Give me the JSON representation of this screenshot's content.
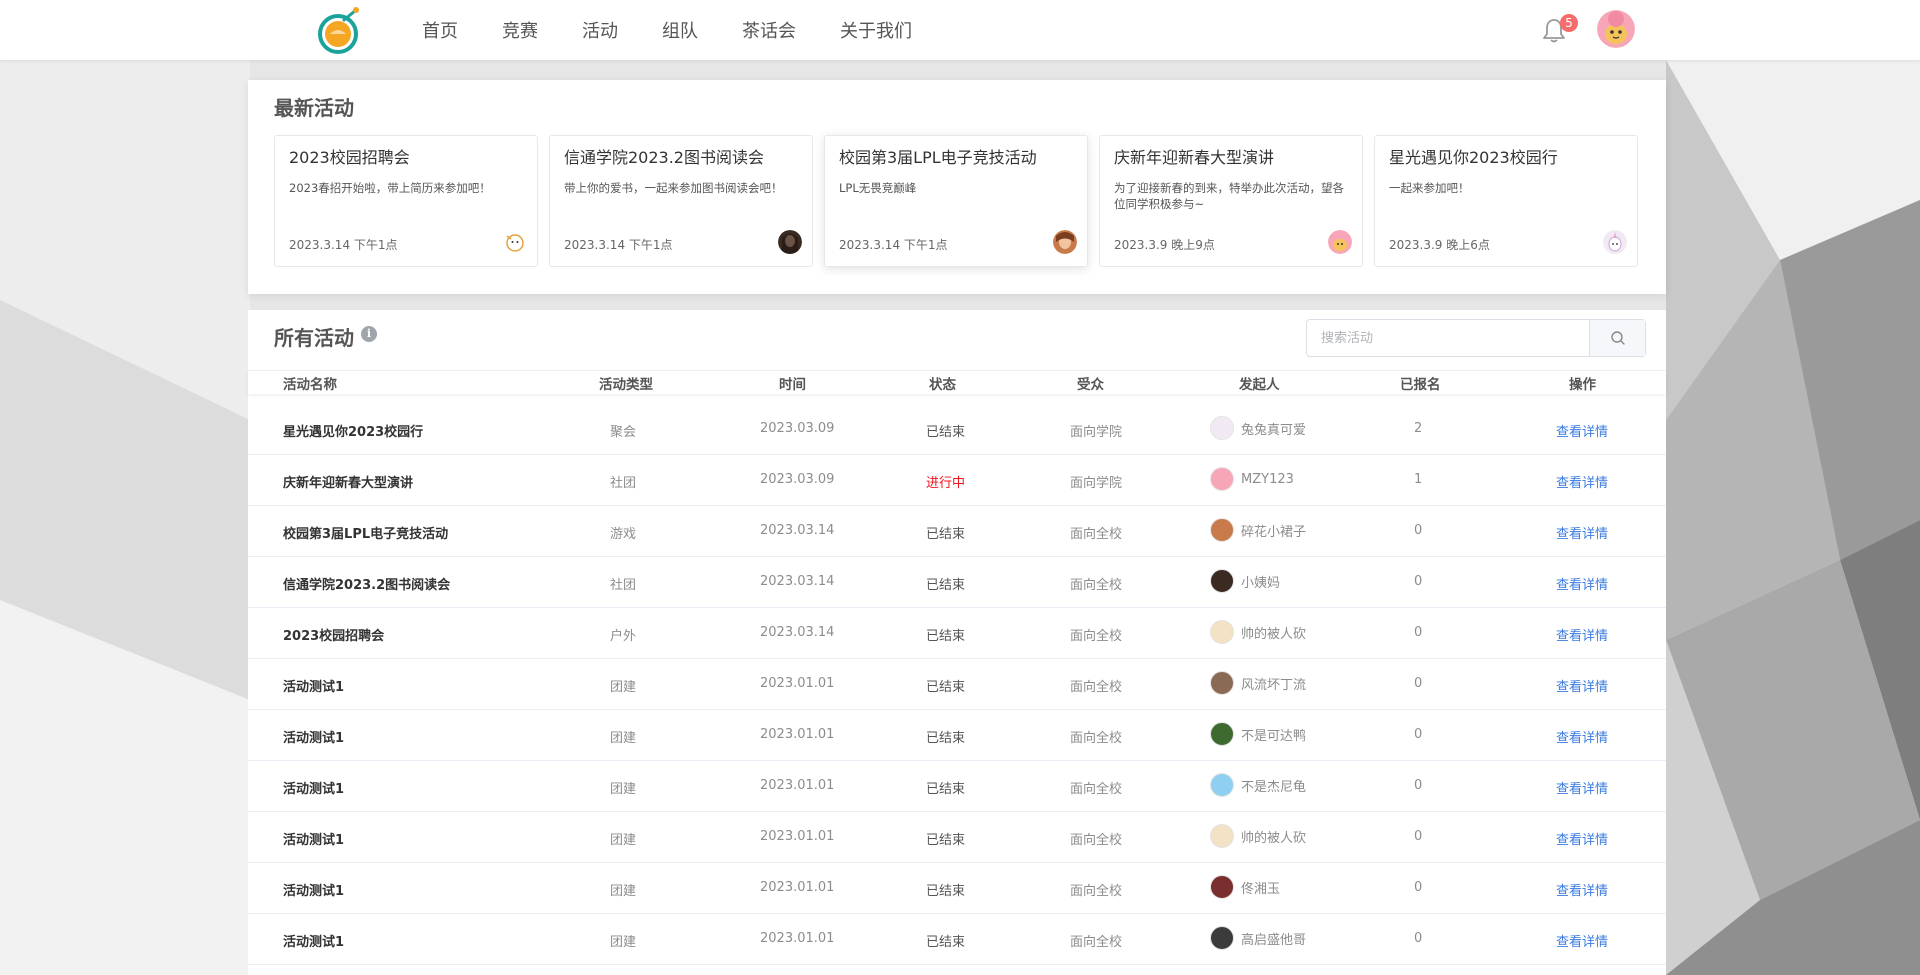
{
  "nav": {
    "items": [
      "首页",
      "竞赛",
      "活动",
      "组队",
      "茶话会",
      "关于我们"
    ]
  },
  "header": {
    "notification_count": "5"
  },
  "latest": {
    "title": "最新活动",
    "cards": [
      {
        "title": "2023校园招聘会",
        "desc": "2023春招开始啦，带上简历来参加吧！",
        "time": "2023.3.14 下午1点",
        "avatar_icon": "cartoon-avatar-icon"
      },
      {
        "title": "信通学院2023.2图书阅读会",
        "desc": "带上你的爱书，一起来参加图书阅读会吧！",
        "time": "2023.3.14 下午1点",
        "avatar_icon": "photo-avatar-icon"
      },
      {
        "title": "校园第3届LPL电子竞技活动",
        "desc": "LPL无畏竞巅峰",
        "time": "2023.3.14 下午1点",
        "avatar_icon": "photo-avatar-icon"
      },
      {
        "title": "庆新年迎新春大型演讲",
        "desc": "为了迎接新春的到来，特举办此次活动，望各位同学积极参与~",
        "time": "2023.3.9 晚上9点",
        "avatar_icon": "dog-avatar-icon"
      },
      {
        "title": "星光遇见你2023校园行",
        "desc": "一起来参加吧！",
        "time": "2023.3.9 晚上6点",
        "avatar_icon": "unicorn-avatar-icon"
      }
    ]
  },
  "all": {
    "title": "所有活动",
    "search_placeholder": "搜索活动",
    "columns": [
      "活动名称",
      "活动类型",
      "时间",
      "状态",
      "受众",
      "发起人",
      "已报名",
      "操作"
    ],
    "rows": [
      {
        "name": "星光遇见你2023校园行",
        "type": "聚会",
        "date": "2023.03.09",
        "status": "已结束",
        "active": false,
        "audience": "面向学院",
        "organizer": "兔兔真可爱",
        "count": "2",
        "action": "查看详情"
      },
      {
        "name": "庆新年迎新春大型演讲",
        "type": "社团",
        "date": "2023.03.09",
        "status": "进行中",
        "active": true,
        "audience": "面向学院",
        "organizer": "MZY123",
        "count": "1",
        "action": "查看详情"
      },
      {
        "name": "校园第3届LPL电子竞技活动",
        "type": "游戏",
        "date": "2023.03.14",
        "status": "已结束",
        "active": false,
        "audience": "面向全校",
        "organizer": "碎花小裙子",
        "count": "0",
        "action": "查看详情"
      },
      {
        "name": "信通学院2023.2图书阅读会",
        "type": "社团",
        "date": "2023.03.14",
        "status": "已结束",
        "active": false,
        "audience": "面向全校",
        "organizer": "小姨妈",
        "count": "0",
        "action": "查看详情"
      },
      {
        "name": "2023校园招聘会",
        "type": "户外",
        "date": "2023.03.14",
        "status": "已结束",
        "active": false,
        "audience": "面向全校",
        "organizer": "帅的被人砍",
        "count": "0",
        "action": "查看详情"
      },
      {
        "name": "活动测试1",
        "type": "团建",
        "date": "2023.01.01",
        "status": "已结束",
        "active": false,
        "audience": "面向全校",
        "organizer": "风流坏丁流",
        "count": "0",
        "action": "查看详情"
      },
      {
        "name": "活动测试1",
        "type": "团建",
        "date": "2023.01.01",
        "status": "已结束",
        "active": false,
        "audience": "面向全校",
        "organizer": "不是可达鸭",
        "count": "0",
        "action": "查看详情"
      },
      {
        "name": "活动测试1",
        "type": "团建",
        "date": "2023.01.01",
        "status": "已结束",
        "active": false,
        "audience": "面向全校",
        "organizer": "不是杰尼龟",
        "count": "0",
        "action": "查看详情"
      },
      {
        "name": "活动测试1",
        "type": "团建",
        "date": "2023.01.01",
        "status": "已结束",
        "active": false,
        "audience": "面向全校",
        "organizer": "帅的被人砍",
        "count": "0",
        "action": "查看详情"
      },
      {
        "name": "活动测试1",
        "type": "团建",
        "date": "2023.01.01",
        "status": "已结束",
        "active": false,
        "audience": "面向全校",
        "organizer": "佟湘玉",
        "count": "0",
        "action": "查看详情"
      },
      {
        "name": "活动测试1",
        "type": "团建",
        "date": "2023.01.01",
        "status": "已结束",
        "active": false,
        "audience": "面向全校",
        "organizer": "高启盛他哥",
        "count": "0",
        "action": "查看详情"
      }
    ]
  },
  "colors": {
    "active_status": "#f0141e",
    "link": "#3a7be0",
    "badge": "#f56c6c",
    "logo_orange": "#f5a623",
    "logo_teal": "#1aa39a"
  }
}
